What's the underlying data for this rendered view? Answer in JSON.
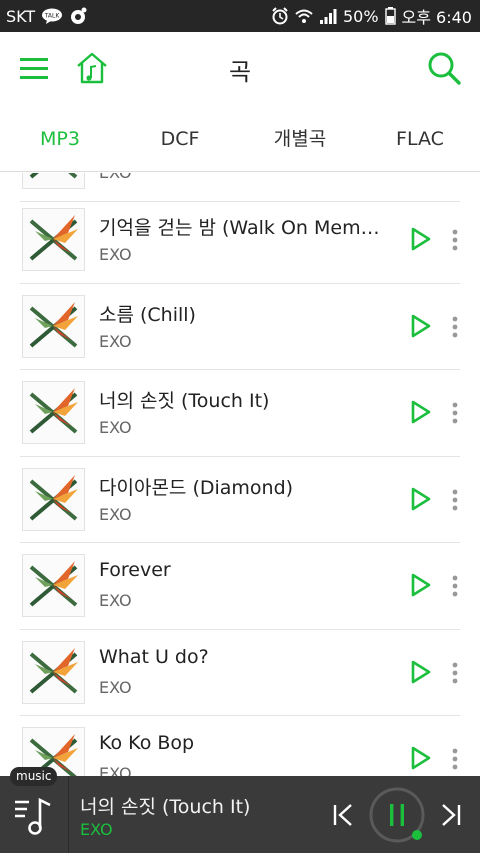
{
  "status": {
    "carrier": "SKT",
    "battery": "50%",
    "time": "오후 6:40"
  },
  "header": {
    "title": "곡",
    "menu_icon": "hamburger-menu-icon",
    "home_icon": "home-music-icon",
    "search_icon": "search-icon"
  },
  "tabs": [
    {
      "label": "MP3",
      "active": true
    },
    {
      "label": "DCF",
      "active": false
    },
    {
      "label": "개별곡",
      "active": false
    },
    {
      "label": "FLAC",
      "active": false
    }
  ],
  "songs": [
    {
      "title": "",
      "artist": "EXO"
    },
    {
      "title": "기억을 걷는 밤 (Walk On Memories)",
      "artist": "EXO"
    },
    {
      "title": "소름 (Chill)",
      "artist": "EXO"
    },
    {
      "title": "너의 손짓 (Touch It)",
      "artist": "EXO"
    },
    {
      "title": "다이아몬드 (Diamond)",
      "artist": "EXO"
    },
    {
      "title": "Forever",
      "artist": "EXO"
    },
    {
      "title": "What U do?",
      "artist": "EXO"
    },
    {
      "title": "Ko Ko Bop",
      "artist": "EXO"
    }
  ],
  "player": {
    "badge": "music",
    "title": "너의 손짓 (Touch It)",
    "artist": "EXO"
  },
  "colors": {
    "accent": "#1bbf3d",
    "status_bar": "#262626",
    "player_bg": "#3a3a3a"
  }
}
